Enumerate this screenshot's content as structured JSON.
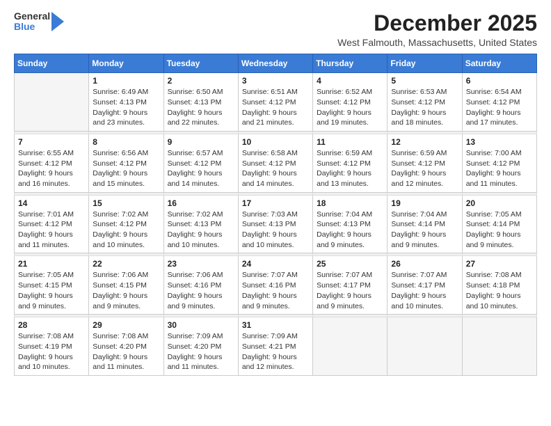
{
  "logo": {
    "general": "General",
    "blue": "Blue"
  },
  "title": "December 2025",
  "subtitle": "West Falmouth, Massachusetts, United States",
  "days_of_week": [
    "Sunday",
    "Monday",
    "Tuesday",
    "Wednesday",
    "Thursday",
    "Friday",
    "Saturday"
  ],
  "weeks": [
    [
      {
        "day": "",
        "sunrise": "",
        "sunset": "",
        "daylight": ""
      },
      {
        "day": "1",
        "sunrise": "Sunrise: 6:49 AM",
        "sunset": "Sunset: 4:13 PM",
        "daylight": "Daylight: 9 hours and 23 minutes."
      },
      {
        "day": "2",
        "sunrise": "Sunrise: 6:50 AM",
        "sunset": "Sunset: 4:13 PM",
        "daylight": "Daylight: 9 hours and 22 minutes."
      },
      {
        "day": "3",
        "sunrise": "Sunrise: 6:51 AM",
        "sunset": "Sunset: 4:12 PM",
        "daylight": "Daylight: 9 hours and 21 minutes."
      },
      {
        "day": "4",
        "sunrise": "Sunrise: 6:52 AM",
        "sunset": "Sunset: 4:12 PM",
        "daylight": "Daylight: 9 hours and 19 minutes."
      },
      {
        "day": "5",
        "sunrise": "Sunrise: 6:53 AM",
        "sunset": "Sunset: 4:12 PM",
        "daylight": "Daylight: 9 hours and 18 minutes."
      },
      {
        "day": "6",
        "sunrise": "Sunrise: 6:54 AM",
        "sunset": "Sunset: 4:12 PM",
        "daylight": "Daylight: 9 hours and 17 minutes."
      }
    ],
    [
      {
        "day": "7",
        "sunrise": "Sunrise: 6:55 AM",
        "sunset": "Sunset: 4:12 PM",
        "daylight": "Daylight: 9 hours and 16 minutes."
      },
      {
        "day": "8",
        "sunrise": "Sunrise: 6:56 AM",
        "sunset": "Sunset: 4:12 PM",
        "daylight": "Daylight: 9 hours and 15 minutes."
      },
      {
        "day": "9",
        "sunrise": "Sunrise: 6:57 AM",
        "sunset": "Sunset: 4:12 PM",
        "daylight": "Daylight: 9 hours and 14 minutes."
      },
      {
        "day": "10",
        "sunrise": "Sunrise: 6:58 AM",
        "sunset": "Sunset: 4:12 PM",
        "daylight": "Daylight: 9 hours and 14 minutes."
      },
      {
        "day": "11",
        "sunrise": "Sunrise: 6:59 AM",
        "sunset": "Sunset: 4:12 PM",
        "daylight": "Daylight: 9 hours and 13 minutes."
      },
      {
        "day": "12",
        "sunrise": "Sunrise: 6:59 AM",
        "sunset": "Sunset: 4:12 PM",
        "daylight": "Daylight: 9 hours and 12 minutes."
      },
      {
        "day": "13",
        "sunrise": "Sunrise: 7:00 AM",
        "sunset": "Sunset: 4:12 PM",
        "daylight": "Daylight: 9 hours and 11 minutes."
      }
    ],
    [
      {
        "day": "14",
        "sunrise": "Sunrise: 7:01 AM",
        "sunset": "Sunset: 4:12 PM",
        "daylight": "Daylight: 9 hours and 11 minutes."
      },
      {
        "day": "15",
        "sunrise": "Sunrise: 7:02 AM",
        "sunset": "Sunset: 4:12 PM",
        "daylight": "Daylight: 9 hours and 10 minutes."
      },
      {
        "day": "16",
        "sunrise": "Sunrise: 7:02 AM",
        "sunset": "Sunset: 4:13 PM",
        "daylight": "Daylight: 9 hours and 10 minutes."
      },
      {
        "day": "17",
        "sunrise": "Sunrise: 7:03 AM",
        "sunset": "Sunset: 4:13 PM",
        "daylight": "Daylight: 9 hours and 10 minutes."
      },
      {
        "day": "18",
        "sunrise": "Sunrise: 7:04 AM",
        "sunset": "Sunset: 4:13 PM",
        "daylight": "Daylight: 9 hours and 9 minutes."
      },
      {
        "day": "19",
        "sunrise": "Sunrise: 7:04 AM",
        "sunset": "Sunset: 4:14 PM",
        "daylight": "Daylight: 9 hours and 9 minutes."
      },
      {
        "day": "20",
        "sunrise": "Sunrise: 7:05 AM",
        "sunset": "Sunset: 4:14 PM",
        "daylight": "Daylight: 9 hours and 9 minutes."
      }
    ],
    [
      {
        "day": "21",
        "sunrise": "Sunrise: 7:05 AM",
        "sunset": "Sunset: 4:15 PM",
        "daylight": "Daylight: 9 hours and 9 minutes."
      },
      {
        "day": "22",
        "sunrise": "Sunrise: 7:06 AM",
        "sunset": "Sunset: 4:15 PM",
        "daylight": "Daylight: 9 hours and 9 minutes."
      },
      {
        "day": "23",
        "sunrise": "Sunrise: 7:06 AM",
        "sunset": "Sunset: 4:16 PM",
        "daylight": "Daylight: 9 hours and 9 minutes."
      },
      {
        "day": "24",
        "sunrise": "Sunrise: 7:07 AM",
        "sunset": "Sunset: 4:16 PM",
        "daylight": "Daylight: 9 hours and 9 minutes."
      },
      {
        "day": "25",
        "sunrise": "Sunrise: 7:07 AM",
        "sunset": "Sunset: 4:17 PM",
        "daylight": "Daylight: 9 hours and 9 minutes."
      },
      {
        "day": "26",
        "sunrise": "Sunrise: 7:07 AM",
        "sunset": "Sunset: 4:17 PM",
        "daylight": "Daylight: 9 hours and 10 minutes."
      },
      {
        "day": "27",
        "sunrise": "Sunrise: 7:08 AM",
        "sunset": "Sunset: 4:18 PM",
        "daylight": "Daylight: 9 hours and 10 minutes."
      }
    ],
    [
      {
        "day": "28",
        "sunrise": "Sunrise: 7:08 AM",
        "sunset": "Sunset: 4:19 PM",
        "daylight": "Daylight: 9 hours and 10 minutes."
      },
      {
        "day": "29",
        "sunrise": "Sunrise: 7:08 AM",
        "sunset": "Sunset: 4:20 PM",
        "daylight": "Daylight: 9 hours and 11 minutes."
      },
      {
        "day": "30",
        "sunrise": "Sunrise: 7:09 AM",
        "sunset": "Sunset: 4:20 PM",
        "daylight": "Daylight: 9 hours and 11 minutes."
      },
      {
        "day": "31",
        "sunrise": "Sunrise: 7:09 AM",
        "sunset": "Sunset: 4:21 PM",
        "daylight": "Daylight: 9 hours and 12 minutes."
      },
      {
        "day": "",
        "sunrise": "",
        "sunset": "",
        "daylight": ""
      },
      {
        "day": "",
        "sunrise": "",
        "sunset": "",
        "daylight": ""
      },
      {
        "day": "",
        "sunrise": "",
        "sunset": "",
        "daylight": ""
      }
    ]
  ],
  "accent_color": "#3a7bd5"
}
